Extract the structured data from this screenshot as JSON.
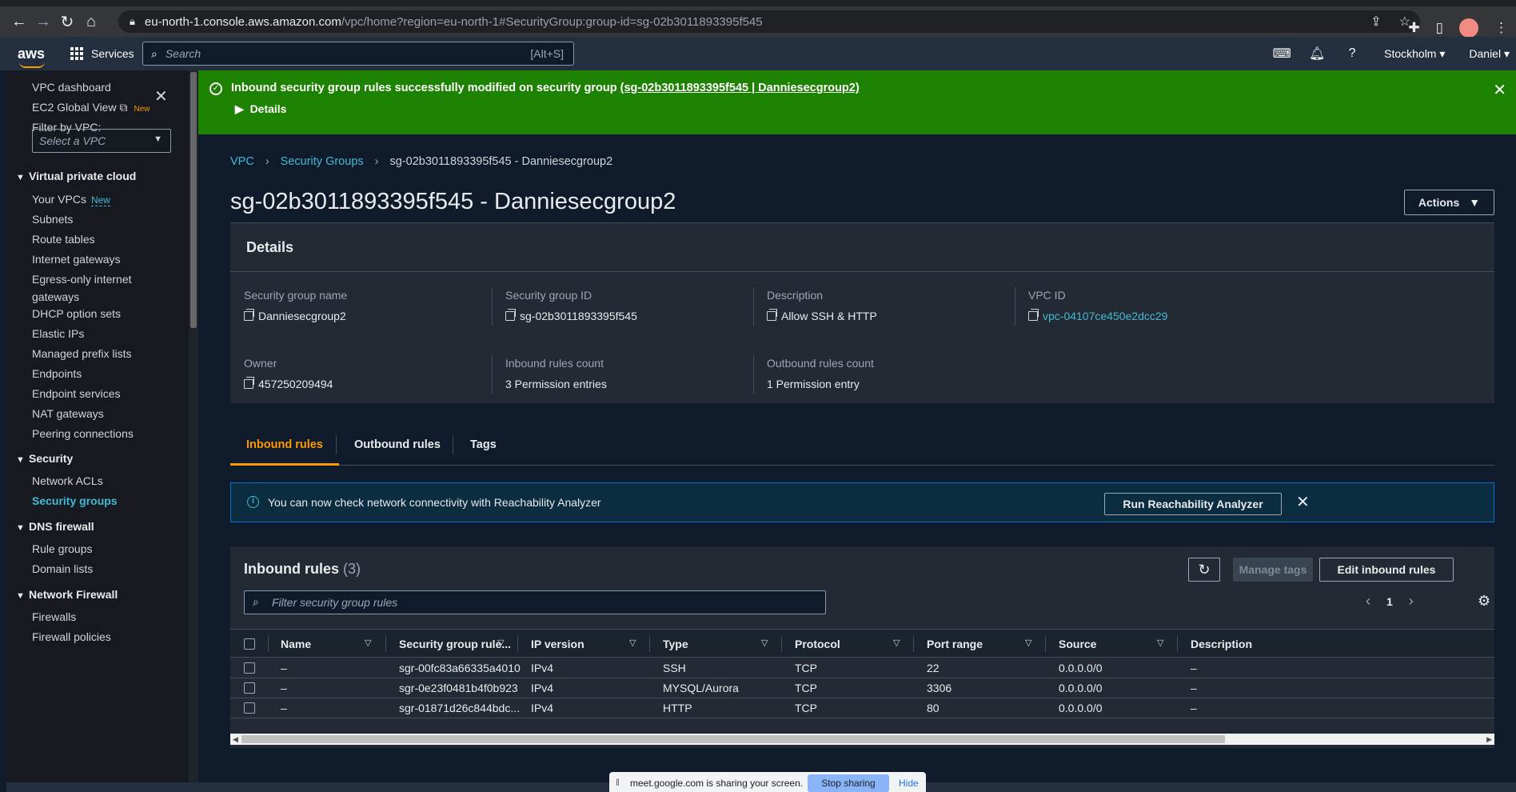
{
  "browser": {
    "url_host": "eu-north-1.console.aws.amazon.com",
    "url_path": "/vpc/home?region=eu-north-1#SecurityGroup:group-id=sg-02b3011893395f545"
  },
  "aws_nav": {
    "logo": "aws",
    "services_label": "Services",
    "search_placeholder": "Search",
    "search_shortcut": "[Alt+S]",
    "region": "Stockholm ▾",
    "user": "Daniel ▾"
  },
  "sidebar": {
    "top_items": [
      {
        "label": "VPC dashboard"
      },
      {
        "label": "EC2 Global View",
        "badge": "New"
      }
    ],
    "filter_label": "Filter by VPC:",
    "filter_placeholder": "Select a VPC",
    "sections": [
      {
        "title": "Virtual private cloud",
        "items": [
          "Your VPCs",
          "Subnets",
          "Route tables",
          "Internet gateways",
          "Egress-only internet",
          "gateways",
          "DHCP option sets",
          "Elastic IPs",
          "Managed prefix lists",
          "Endpoints",
          "Endpoint services",
          "NAT gateways",
          "Peering connections"
        ]
      },
      {
        "title": "Security",
        "items": [
          "Network ACLs",
          "Security groups"
        ]
      },
      {
        "title": "DNS firewall",
        "items": [
          "Rule groups",
          "Domain lists"
        ]
      },
      {
        "title": "Network Firewall",
        "items": [
          "Firewalls",
          "Firewall policies"
        ]
      }
    ],
    "your_vpcs_badge": "New"
  },
  "flash": {
    "message": "Inbound security group rules successfully modified on security group ",
    "link": "(sg-02b3011893395f545 | Danniesecgroup2)",
    "details": "Details"
  },
  "breadcrumb": [
    "VPC",
    "Security Groups",
    "sg-02b3011893395f545 - Danniesecgroup2"
  ],
  "page_title": "sg-02b3011893395f545 - Danniesecgroup2",
  "actions_label": "Actions",
  "details": {
    "header": "Details",
    "fields": {
      "sg_name": {
        "label": "Security group name",
        "value": "Danniesecgroup2"
      },
      "sg_id": {
        "label": "Security group ID",
        "value": "sg-02b3011893395f545"
      },
      "description": {
        "label": "Description",
        "value": "Allow SSH & HTTP"
      },
      "vpc_id": {
        "label": "VPC ID",
        "value": "vpc-04107ce450e2dcc29"
      },
      "owner": {
        "label": "Owner",
        "value": "457250209494"
      },
      "inbound_count": {
        "label": "Inbound rules count",
        "value": "3 Permission entries"
      },
      "outbound_count": {
        "label": "Outbound rules count",
        "value": "1 Permission entry"
      }
    }
  },
  "tabs": [
    "Inbound rules",
    "Outbound rules",
    "Tags"
  ],
  "info_banner": {
    "text": "You can now check network connectivity with Reachability Analyzer",
    "button": "Run Reachability Analyzer"
  },
  "inbound": {
    "title": "Inbound rules",
    "count": "(3)",
    "manage_tags": "Manage tags",
    "edit_label": "Edit inbound rules",
    "filter_placeholder": "Filter security group rules",
    "page": "1",
    "columns": [
      "Name",
      "Security group rule...",
      "IP version",
      "Type",
      "Protocol",
      "Port range",
      "Source",
      "Description"
    ],
    "rows": [
      [
        "–",
        "sgr-00fc83a66335a4010",
        "IPv4",
        "SSH",
        "TCP",
        "22",
        "0.0.0.0/0",
        "–"
      ],
      [
        "–",
        "sgr-0e23f0481b4f0b923",
        "IPv4",
        "MYSQL/Aurora",
        "TCP",
        "3306",
        "0.0.0.0/0",
        "–"
      ],
      [
        "–",
        "sgr-01871d26c844bdc...",
        "IPv4",
        "HTTP",
        "TCP",
        "80",
        "0.0.0.0/0",
        "–"
      ]
    ]
  },
  "share_bar": {
    "text": "meet.google.com is sharing your screen.",
    "stop": "Stop sharing",
    "hide": "Hide"
  }
}
